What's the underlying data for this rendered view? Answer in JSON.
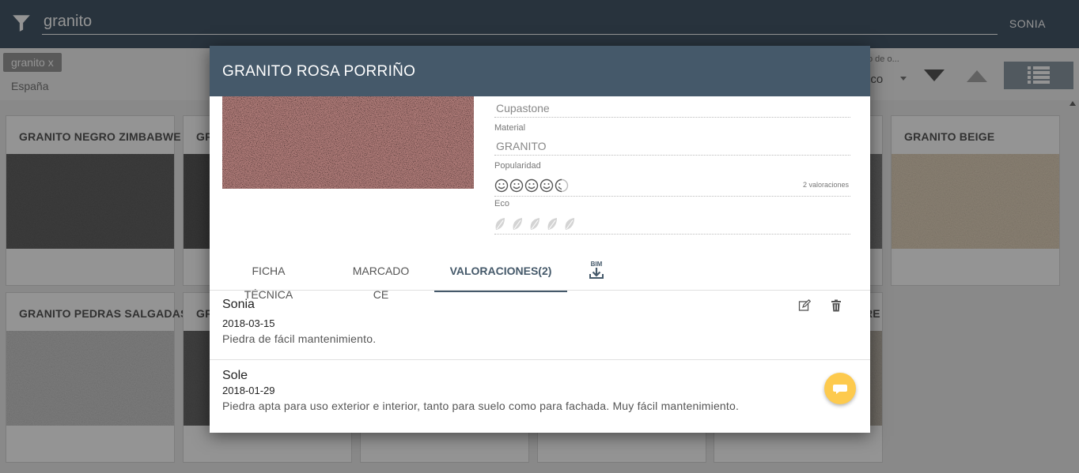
{
  "search": {
    "value": "granito"
  },
  "user": {
    "name": "SONIA"
  },
  "filters": {
    "chip_label": "granito x",
    "country": "España"
  },
  "sort": {
    "label": "o de o...",
    "value": "ico"
  },
  "cards": [
    {
      "title": "GRANITO NEGRO ZIMBABWE"
    },
    {
      "title": "GR"
    },
    {
      "title": "GRANITO BEIGE"
    },
    {
      "title": "GRANITO PEDRAS SALGADAS"
    },
    {
      "title": "GR"
    },
    {
      "title": "RE"
    }
  ],
  "modal": {
    "title": "GRANITO ROSA PORRIÑO",
    "supplier": "Cupastone",
    "material_label": "Material",
    "material": "GRANITO",
    "popularity_label": "Popularidad",
    "popularity_rating": 4.5,
    "ratings_count": "2 valoraciones",
    "eco_label": "Eco",
    "eco_rating": 0,
    "tabs": [
      "FICHA TÉCNICA",
      "MARCADO CE",
      "VALORACIONES(2)"
    ],
    "active_tab": 2,
    "bim_label": "BIM",
    "reviews": [
      {
        "author": "Sonia",
        "date": "2018-03-15",
        "text": "Piedra de fácil mantenimiento."
      },
      {
        "author": "Sole",
        "date": "2018-01-29",
        "text": "Piedra apta para uso exterior e interior, tanto para suelo como para fachada. Muy fácil mantenimiento."
      }
    ]
  },
  "colors": {
    "primary": "#45596a",
    "accent": "#fdca4e"
  },
  "icons": [
    "filter-icon",
    "list-view-icon",
    "smiley-icon",
    "leaf-icon",
    "bim-download-icon",
    "edit-icon",
    "delete-icon",
    "comment-icon"
  ]
}
